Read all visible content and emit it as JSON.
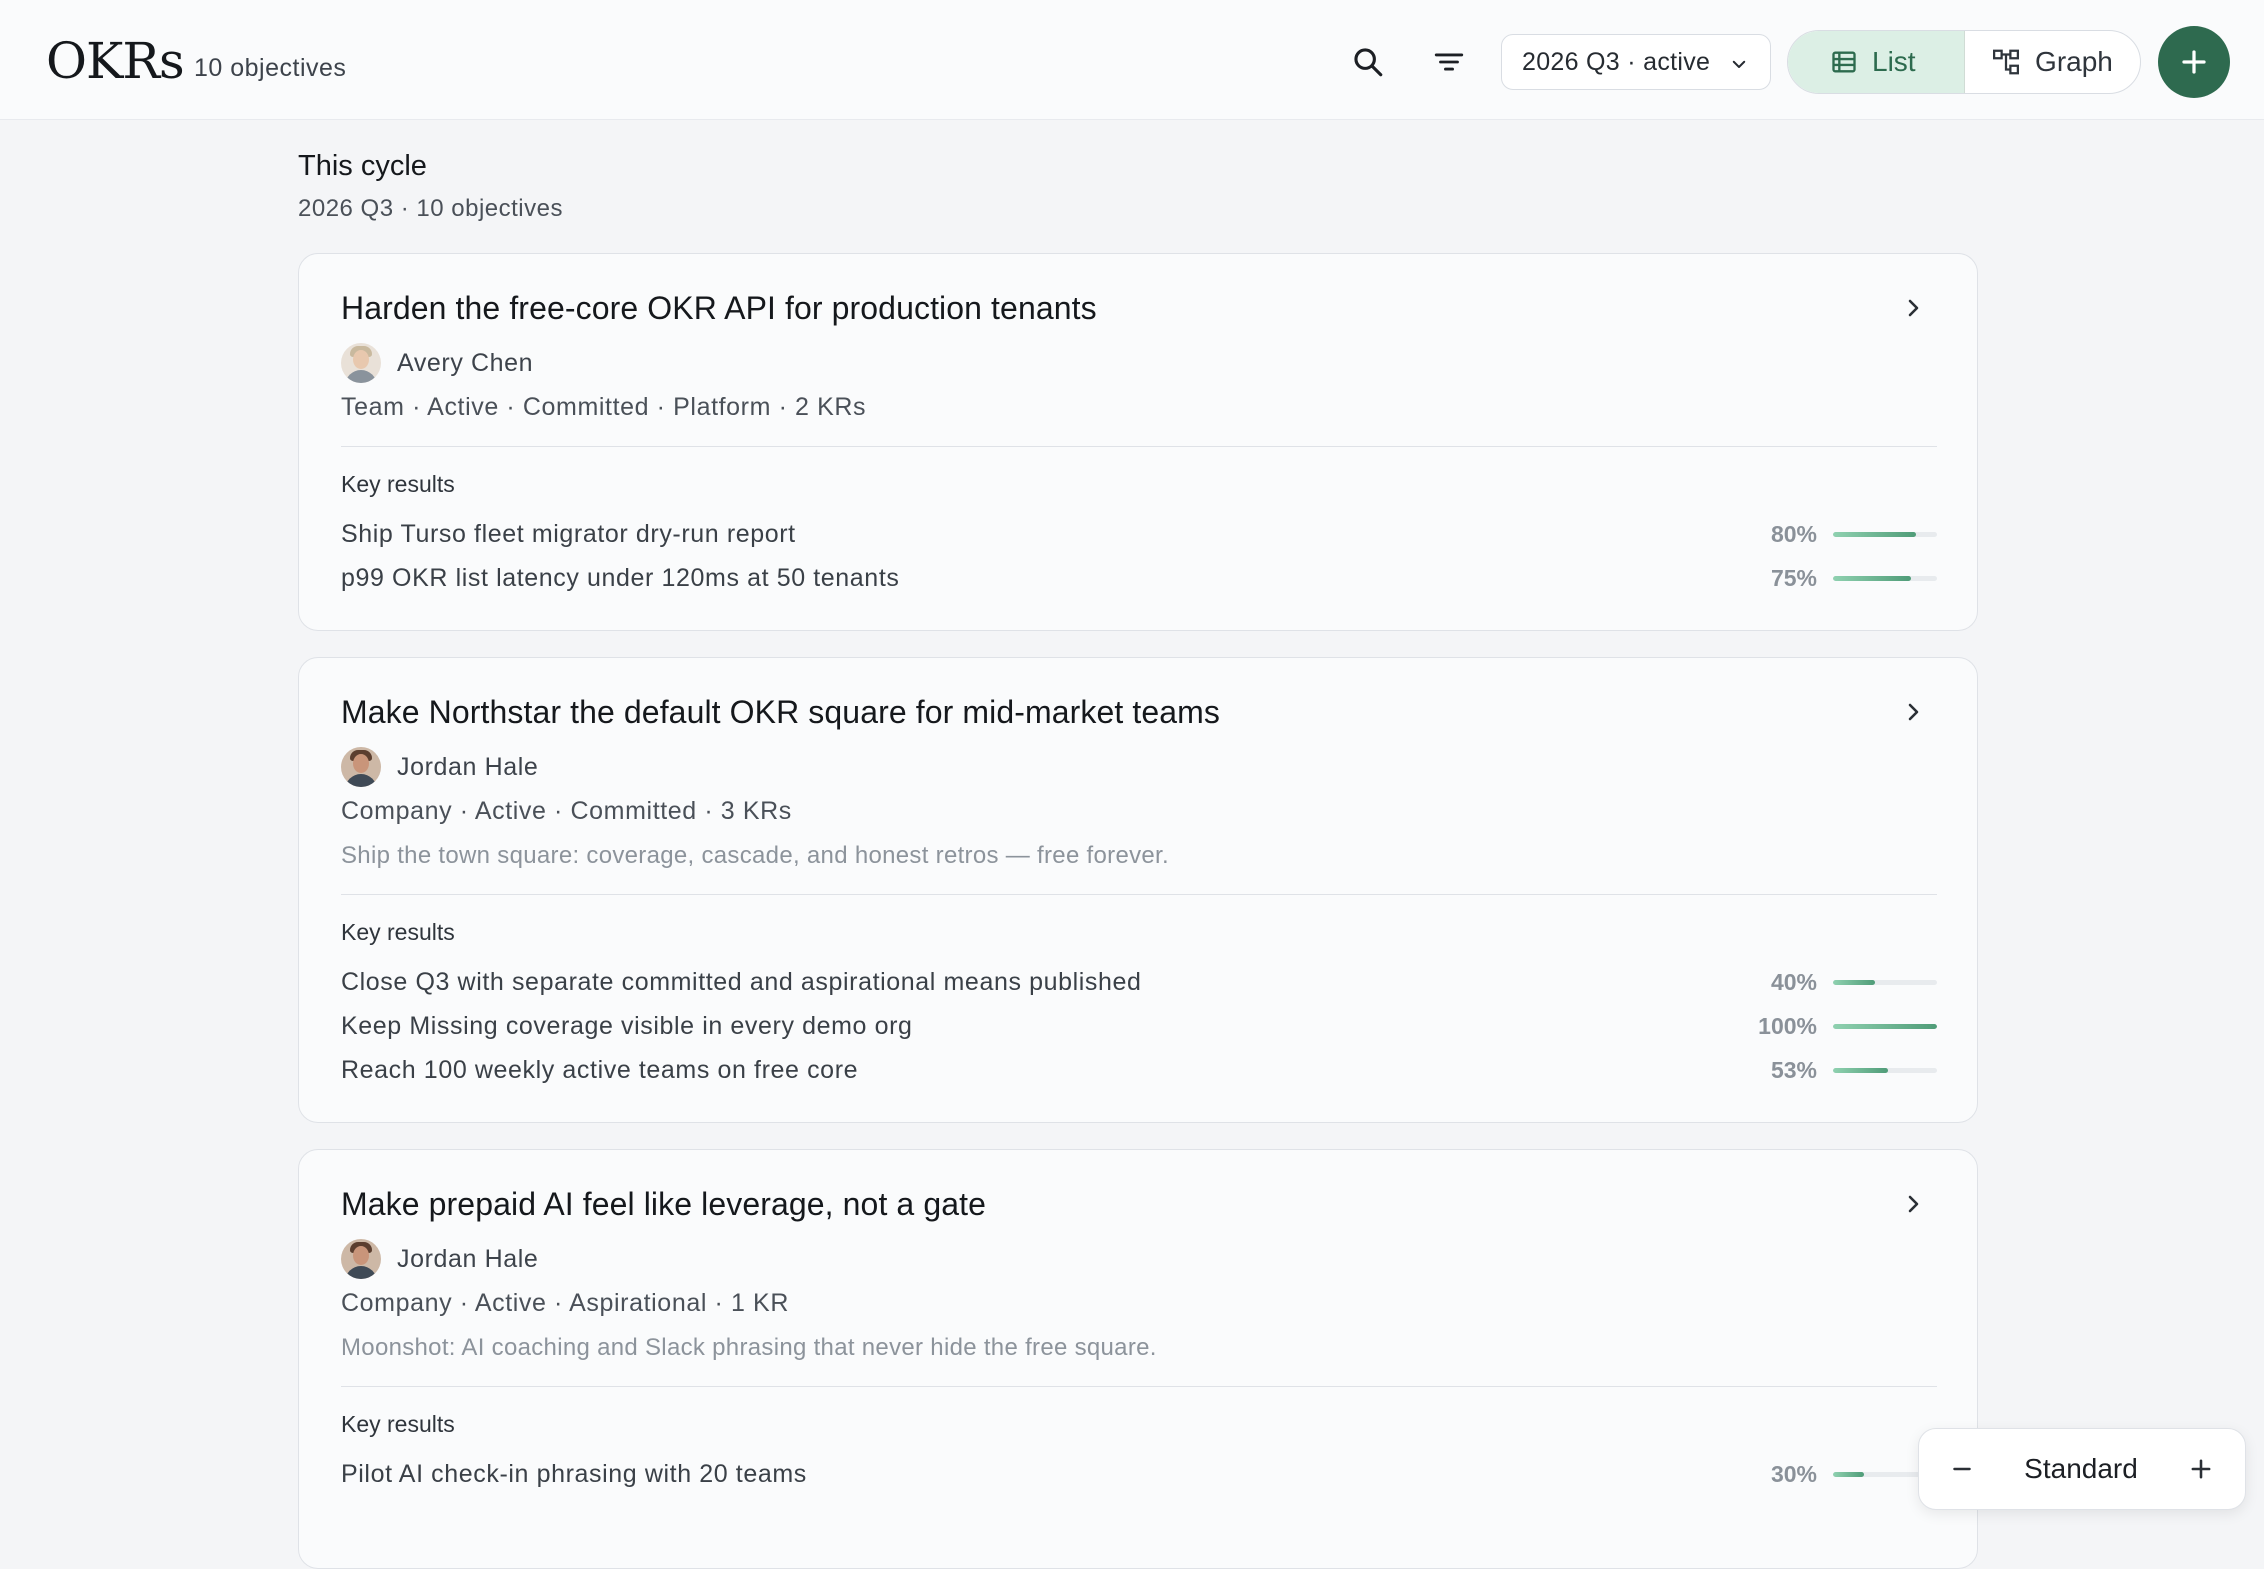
{
  "header": {
    "brand": "OKRs",
    "objective_count": "10 objectives",
    "cycle_select": "2026 Q3 · active",
    "view_list": "List",
    "view_graph": "Graph"
  },
  "section": {
    "title": "This cycle",
    "subtitle": "2026 Q3 · 10 objectives"
  },
  "key_results_heading": "Key results",
  "objectives": [
    {
      "title": "Harden the free-core OKR API for production tenants",
      "owner": "Avery Chen",
      "meta": "Team · Active · Committed · Platform · 2 KRs",
      "description": "",
      "key_results": [
        {
          "text": "Ship Turso fleet migrator dry-run report",
          "pct_label": "80%",
          "progress": 80
        },
        {
          "text": "p99 OKR list latency under 120ms at 50 tenants",
          "pct_label": "75%",
          "progress": 75
        }
      ]
    },
    {
      "title": "Make Northstar the default OKR square for mid-market teams",
      "owner": "Jordan Hale",
      "meta": "Company · Active · Committed · 3 KRs",
      "description": "Ship the town square: coverage, cascade, and honest retros — free forever.",
      "key_results": [
        {
          "text": "Close Q3 with separate committed and aspirational means published",
          "pct_label": "40%",
          "progress": 40
        },
        {
          "text": "Keep Missing coverage visible in every demo org",
          "pct_label": "100%",
          "progress": 100
        },
        {
          "text": "Reach 100 weekly active teams on free core",
          "pct_label": "53%",
          "progress": 53
        }
      ]
    },
    {
      "title": "Make prepaid AI feel like leverage, not a gate",
      "owner": "Jordan Hale",
      "meta": "Company · Active · Aspirational · 1 KR",
      "description": "Moonshot: AI coaching and Slack phrasing that never hide the free square.",
      "key_results": [
        {
          "text": "Pilot AI check-in phrasing with 20 teams",
          "pct_label": "30%",
          "progress": 30
        }
      ]
    }
  ],
  "density": {
    "label": "Standard"
  },
  "colors": {
    "accent": "#2e6a4f",
    "accent_soft": "#dcefe5",
    "progress_fill": "#4f9c78"
  }
}
